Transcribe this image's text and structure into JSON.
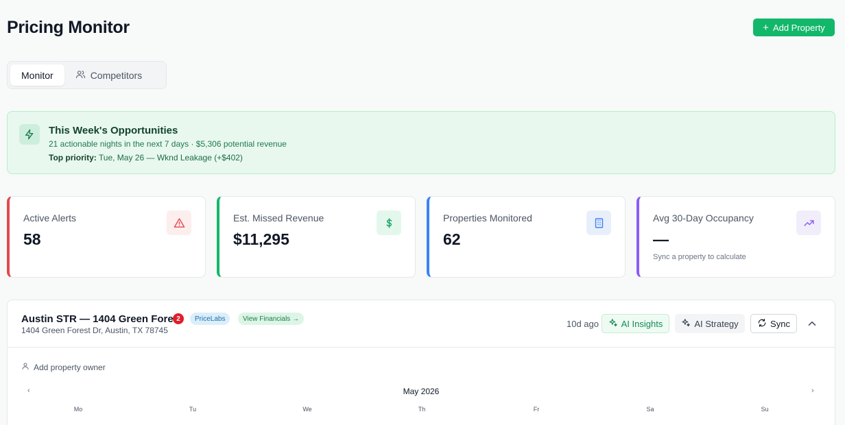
{
  "header": {
    "title": "Pricing Monitor",
    "add_property_label": "Add Property"
  },
  "tabs": [
    {
      "label": "Monitor",
      "active": true
    },
    {
      "label": "Competitors",
      "active": false,
      "icon": "users-icon"
    }
  ],
  "opportunities": {
    "title": "This Week's Opportunities",
    "subtitle": "21 actionable nights in the next 7 days · $5,306 potential revenue",
    "top_priority_label": "Top priority:",
    "top_priority_value": "Tue, May 26 — Wknd Leakage (+$402)",
    "icon": "lightning-icon"
  },
  "stats": [
    {
      "label": "Active Alerts",
      "value": "58",
      "note": "",
      "accent": "#e5484d",
      "icon": "alert-triangle-icon"
    },
    {
      "label": "Est. Missed Revenue",
      "value": "$11,295",
      "note": "",
      "accent": "#12b76a",
      "icon": "dollar-icon"
    },
    {
      "label": "Properties Monitored",
      "value": "62",
      "note": "",
      "accent": "#3b82f6",
      "icon": "building-icon"
    },
    {
      "label": "Avg 30-Day Occupancy",
      "value": "—",
      "note": "Sync a property to calculate",
      "accent": "#8b5cf6",
      "icon": "trending-up-icon"
    }
  ],
  "property": {
    "name": "Austin STR — 1404 Green Forest",
    "alert_count": "2",
    "source_badge": "PriceLabs",
    "financials_link": "View Financials →",
    "address": "1404 Green Forest Dr, Austin, TX 78745",
    "last_sync": "10d ago",
    "ai_insights_label": "AI Insights",
    "ai_strategy_label": "AI Strategy",
    "sync_label": "Sync",
    "owner_label": "Add property owner"
  },
  "calendar": {
    "month": "May 2026",
    "prev": "‹",
    "next": "›",
    "weekdays": [
      "Mo",
      "Tu",
      "We",
      "Th",
      "Fr",
      "Sa",
      "Su"
    ]
  },
  "colors": {
    "brand": "#12b76a",
    "alert_red": "#e11d2a"
  }
}
